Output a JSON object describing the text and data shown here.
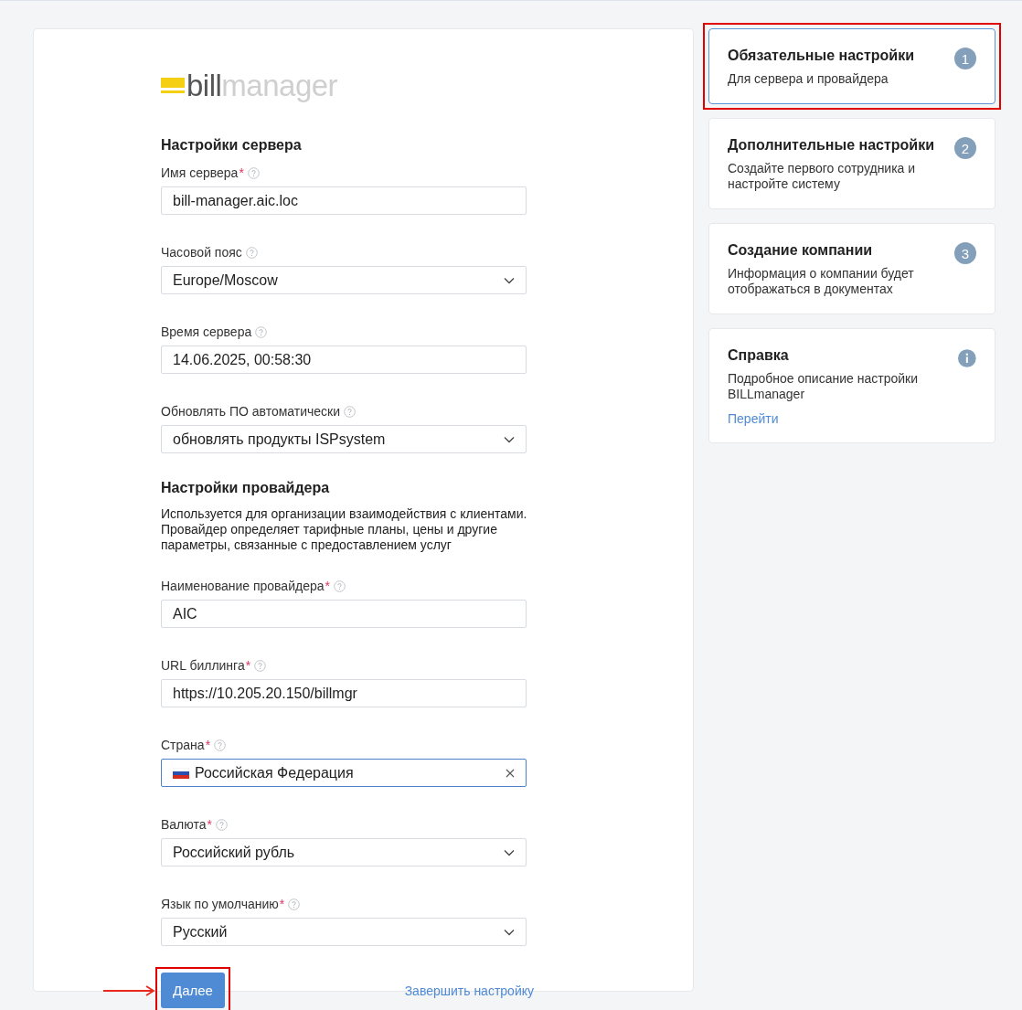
{
  "logo": {
    "strong": "bill",
    "light": "manager"
  },
  "server_section": {
    "title": "Настройки сервера",
    "fields": [
      {
        "kind": "input",
        "label": "Имя сервера",
        "required_mark": "*",
        "value": "bill-manager.aic.loc",
        "focused": false
      },
      {
        "kind": "select",
        "label": "Часовой пояс",
        "value": "Europe/Moscow",
        "focused": false
      },
      {
        "kind": "input",
        "label": "Время сервера",
        "value": "14.06.2025, 00:58:30",
        "focused": false
      },
      {
        "kind": "select",
        "label": "Обновлять ПО автоматически",
        "value": "обновлять продукты ISPsystem",
        "focused": false
      }
    ]
  },
  "provider_section": {
    "title": "Настройки провайдера",
    "description": "Используется для организации взаимодействия с клиентами. Провайдер определяет тарифные планы, цены и другие параметры, связанные с предоставлением услуг",
    "fields": [
      {
        "kind": "input",
        "label": "Наименование провайдера",
        "required_mark": "*",
        "value": "AIC",
        "focused": false
      },
      {
        "kind": "input",
        "label": "URL биллинга",
        "required_mark": "*",
        "value": "https://10.205.20.150/billmgr",
        "focused": false
      },
      {
        "kind": "country",
        "label": "Страна",
        "required_mark": "*",
        "value": "Российская Федерация",
        "focused": true
      },
      {
        "kind": "select",
        "label": "Валюта",
        "required_mark": "*",
        "value": "Российский рубль",
        "focused": false
      },
      {
        "kind": "select",
        "label": "Язык по умолчанию",
        "required_mark": "*",
        "value": "Русский",
        "focused": false
      }
    ]
  },
  "actions": {
    "next": {
      "label": "Далее",
      "highlighted": true,
      "pointer_arrow": true
    },
    "finish_link": "Завершить настройку"
  },
  "steps": [
    {
      "kind": "step",
      "title": "Обязательные настройки",
      "text": "Для сервера и провайдера",
      "badge": "1",
      "selected": true,
      "highlighted": true
    },
    {
      "kind": "step",
      "title": "Дополнительные настройки",
      "text": "Создайте первого сотрудника и настройте систему",
      "badge": "2",
      "selected": false,
      "highlighted": false
    },
    {
      "kind": "step",
      "title": "Создание компании",
      "text": "Информация о компании будет отображаться в документах",
      "badge": "3",
      "selected": false,
      "highlighted": false
    },
    {
      "kind": "help",
      "title": "Справка",
      "text": "Подробное описание настройки BILLmanager",
      "link": "Перейти",
      "selected": false,
      "highlighted": false
    }
  ]
}
